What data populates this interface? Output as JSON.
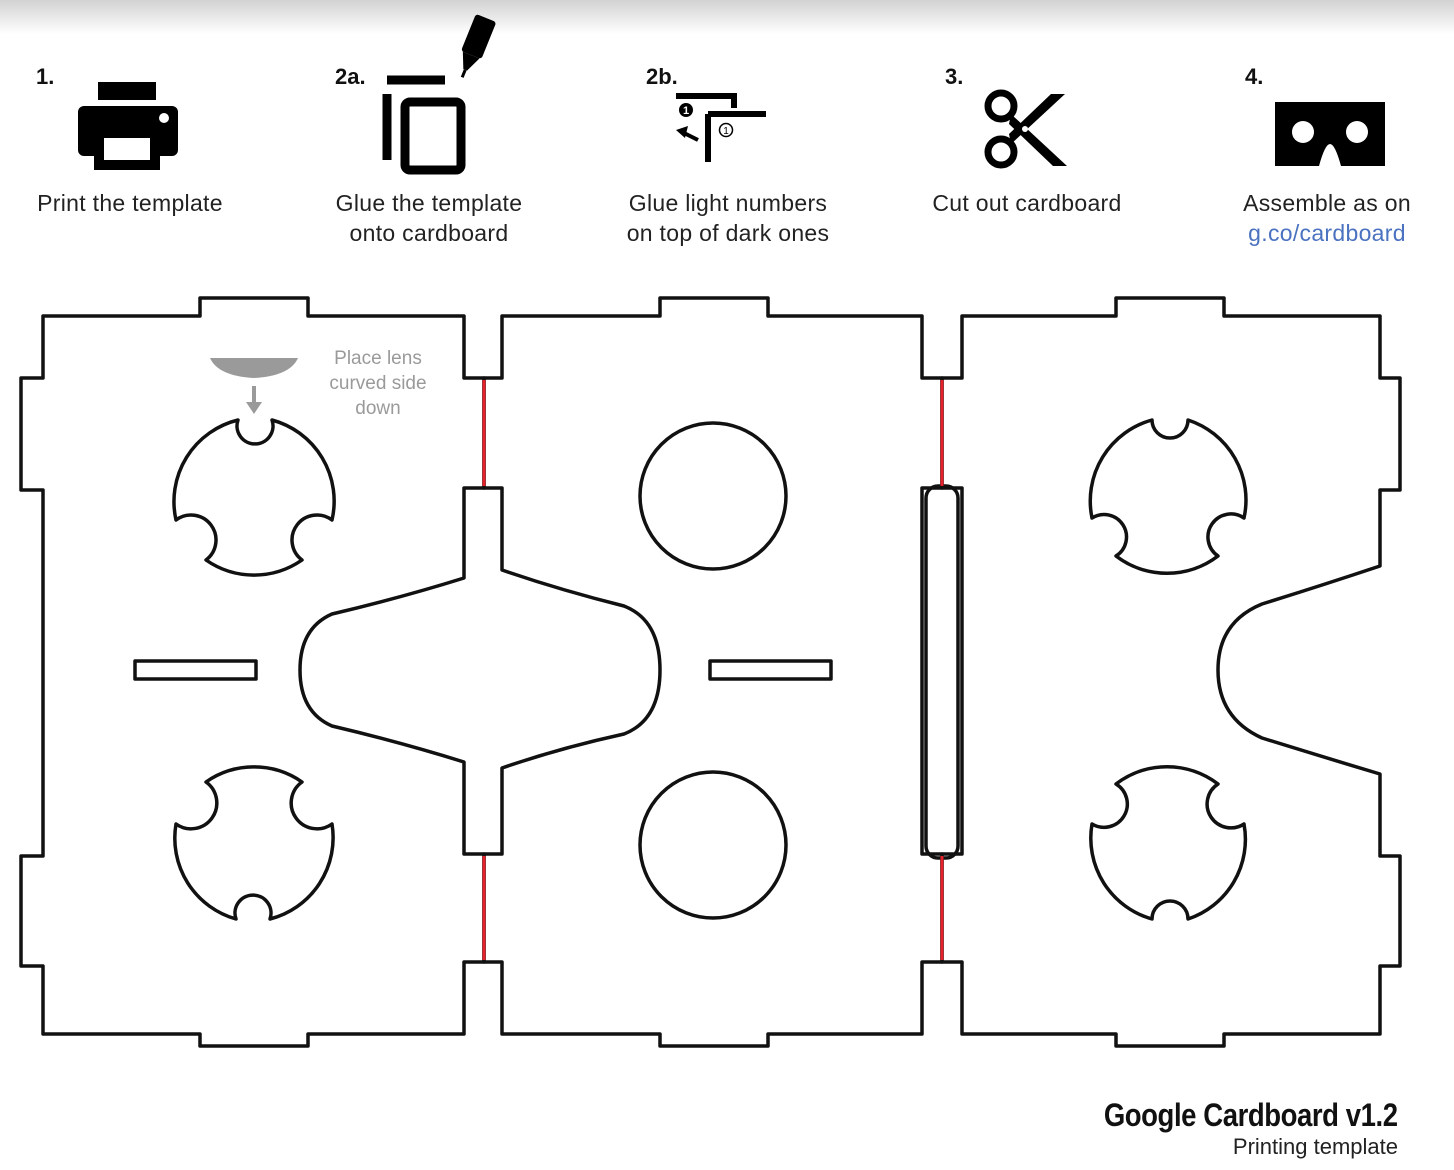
{
  "steps": [
    {
      "number": "1.",
      "lines": [
        "Print the template"
      ],
      "icon": "printer-icon"
    },
    {
      "number": "2a.",
      "lines": [
        "Glue the template",
        "onto cardboard"
      ],
      "icon": "glue-icon"
    },
    {
      "number": "2b.",
      "lines": [
        "Glue light numbers",
        "on top of dark ones"
      ],
      "icon": "overlap-numbers-icon"
    },
    {
      "number": "3.",
      "lines": [
        "Cut out cardboard"
      ],
      "icon": "scissors-icon"
    },
    {
      "number": "4.",
      "lines": [
        "Assemble as on"
      ],
      "link": "g.co/cardboard",
      "icon": "cardboard-viewer-icon"
    }
  ],
  "lens_note": [
    "Place lens",
    "curved side",
    "down"
  ],
  "icon_digits": {
    "dark": "1",
    "light": "1"
  },
  "footer": {
    "title": "Google Cardboard v1.2",
    "subtitle": "Printing template"
  },
  "colors": {
    "cut_line": "#111111",
    "fold_line": "#e8202a",
    "link": "#4a72c0",
    "note": "#9a9a9a"
  }
}
